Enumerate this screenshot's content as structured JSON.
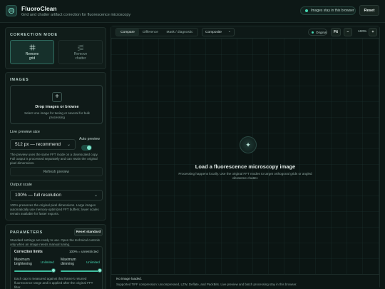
{
  "header": {
    "title": "FluoroClean",
    "subtitle": "Grid and chatter artifact correction for fluorescence microscopy",
    "privacy_badge": "Images stay in this browser",
    "reset_label": "Reset"
  },
  "correction_mode": {
    "title": "CORRECTION MODE",
    "options": [
      {
        "line1": "Remove",
        "line2": "grid",
        "icon": "grid-icon",
        "active": true
      },
      {
        "line1": "Remove",
        "line2": "chatter",
        "icon": "chatter-icon",
        "active": false
      }
    ]
  },
  "images": {
    "title": "IMAGES",
    "drop_title": "Drop images or browse",
    "drop_desc": "Select one image for tuning or several for bulk processing",
    "live_preview_label": "Live preview size",
    "live_preview_value": "512 px — recommend",
    "auto_preview_label": "Auto preview",
    "auto_preview_on": true,
    "preview_help": "The preview uses the same FFT mode on a downscaled copy. Full output is processed separately and can retain the original pixel dimensions.",
    "refresh_label": "Refresh preview",
    "output_scale_label": "Output scale",
    "output_scale_value": "100% — full resolution",
    "output_help": "100% preserves the original pixel dimensions. Large images automatically use memory-optimized FFT buffers; lower scales remain available for faster exports."
  },
  "parameters": {
    "title": "PARAMETERS",
    "reset_standard_label": "Reset standard",
    "desc": "Standard settings are ready to use. Open the technical controls only when an image needs manual tuning.",
    "limits_title": "Correction limits",
    "limits_note": "100% = unrestricted",
    "max_brightening_label": "Maximum brightening",
    "max_brightening_value": "Unlimited",
    "max_dimming_label": "Maximum dimming",
    "max_dimming_value": "Unlimited",
    "max_brightening_level": 1.0,
    "max_dimming_level": 1.0,
    "limits_help": "Each cap is measured against that frame's retuned fluorescence range and is applied after the original FFT filter."
  },
  "toolbar": {
    "tabs": [
      {
        "label": "Compare",
        "active": true
      },
      {
        "label": "Difference",
        "active": false
      },
      {
        "label": "Mask / diagnostic",
        "active": false
      }
    ],
    "view_select": "Composite",
    "original_label": "Original",
    "fit_label": "Fit",
    "zoom_out_label": "−",
    "zoom_value": "100%",
    "zoom_in_label": "+"
  },
  "empty_state": {
    "icon": "sparkle-icon",
    "title": "Load a fluorescence microscopy image",
    "desc": "Processing happens locally. Use the original FFT modes to target orthogonal grids or angled vibratome chatter."
  },
  "status": {
    "line1": "No image loaded.",
    "line2": "Supported TIFF compression: uncompressed, LZW, Deflate, and PackBits. Live preview and batch processing stay in this browser."
  },
  "colors": {
    "accent": "#45d6b2",
    "background": "#0b1513",
    "panel": "#101c19"
  }
}
